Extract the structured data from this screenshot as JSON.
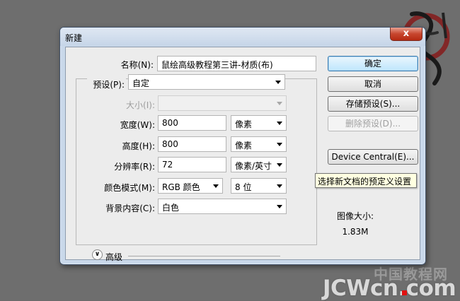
{
  "dialog": {
    "title": "新建",
    "close_label": "x"
  },
  "form": {
    "name": {
      "label": "名称(N):",
      "value": "鼠绘高级教程第三讲-材质(布)"
    },
    "preset": {
      "label": "预设(P):",
      "value": "自定"
    },
    "size": {
      "label": "大小(I):",
      "value": ""
    },
    "width": {
      "label": "宽度(W):",
      "value": "800",
      "unit": "像素"
    },
    "height": {
      "label": "高度(H):",
      "value": "800",
      "unit": "像素"
    },
    "resolution": {
      "label": "分辨率(R):",
      "value": "72",
      "unit": "像素/英寸"
    },
    "color_mode": {
      "label": "颜色模式(M):",
      "value": "RGB 颜色",
      "depth": "8 位"
    },
    "background": {
      "label": "背景内容(C):",
      "value": "白色"
    },
    "advanced_label": "高级"
  },
  "buttons": {
    "ok": "确定",
    "cancel": "取消",
    "save_preset": "存储预设(S)...",
    "delete_preset": "删除预设(D)...",
    "device_central": "Device Central(E)..."
  },
  "tooltip": "选择新文档的预定义设置",
  "image_size": {
    "label": "图像大小:",
    "value": "1.83M"
  },
  "watermark": {
    "cn": "中国教程网",
    "en": "JCWcn.com"
  },
  "colors": {
    "accent": "#3c7fb1",
    "close": "#c7452d",
    "tooltip_bg": "#ffffe1"
  }
}
